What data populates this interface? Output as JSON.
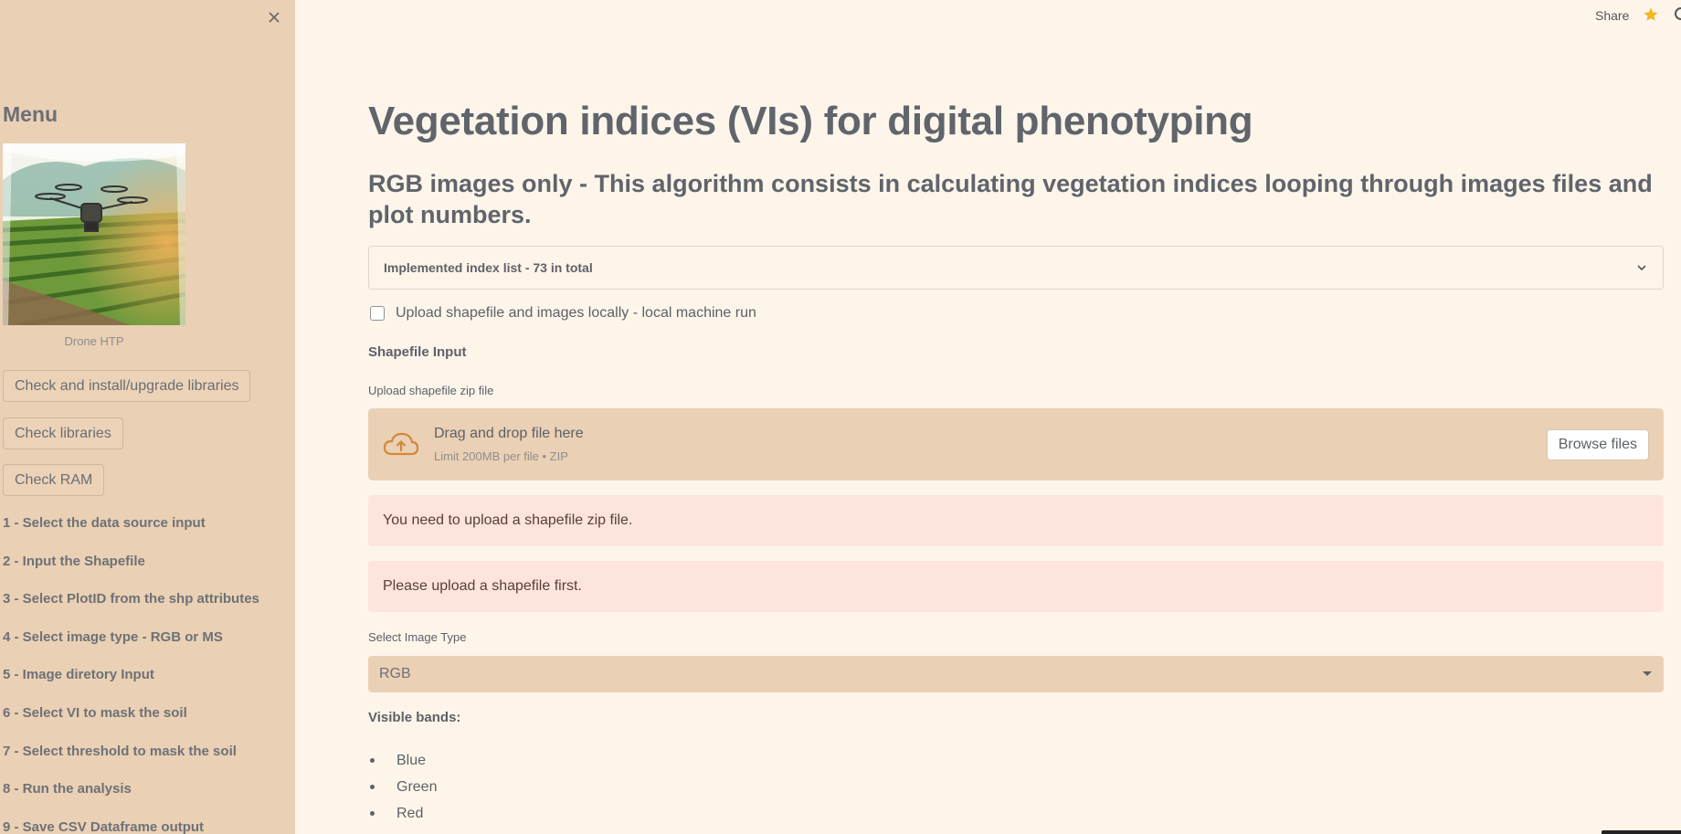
{
  "header": {
    "share_label": "Share"
  },
  "sidebar": {
    "menu_title": "Menu",
    "logo_caption": "Drone HTP",
    "buttons": [
      "Check and install/upgrade libraries",
      "Check libraries",
      "Check RAM"
    ],
    "steps": [
      "1 - Select the data source input",
      "2 - Input the Shapefile",
      "3 - Select PlotID from the shp attributes",
      "4 - Select image type - RGB or MS",
      "5 - Image diretory Input",
      "6 - Select VI to mask the soil",
      "7 - Select threshold to mask the soil",
      "8 - Run the analysis",
      "9 - Save CSV Dataframe output"
    ]
  },
  "main": {
    "title": "Vegetation indices (VIs) for digital phenotyping",
    "subtitle": "RGB images only - This algorithm consists in calculating vegetation indices looping through images files and plot numbers.",
    "expander_label": "Implemented index list - 73 in total",
    "checkbox_label": "Upload shapefile and images locally - local machine run",
    "checkbox_checked": false,
    "shapefile_heading": "Shapefile Input",
    "upload_label": "Upload shapefile zip file",
    "dropzone": {
      "main_text": "Drag and drop file here",
      "sub_text": "Limit 200MB per file • ZIP",
      "browse_label": "Browse files"
    },
    "alerts": [
      "You need to upload a shapefile zip file.",
      "Please upload a shapefile first."
    ],
    "image_type_label": "Select Image Type",
    "image_type_value": "RGB",
    "bands_heading": "Visible bands:",
    "bands": [
      "Blue",
      "Green",
      "Red"
    ]
  },
  "colors": {
    "sidebar_bg": "#ead0b4",
    "page_bg": "#fdf5ea",
    "alert_bg": "#fde4dc",
    "accent_orange": "#d4883a",
    "star": "#f3b61f"
  }
}
